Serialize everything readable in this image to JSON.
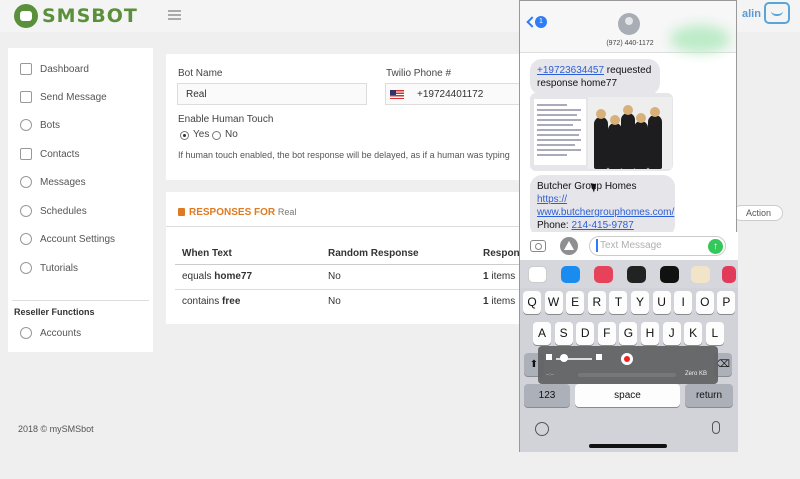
{
  "brand": {
    "name": "SMSBOT"
  },
  "header": {
    "user": "alin"
  },
  "sidebar": {
    "items": [
      {
        "label": "Dashboard"
      },
      {
        "label": "Send Message"
      },
      {
        "label": "Bots"
      },
      {
        "label": "Contacts"
      },
      {
        "label": "Messages"
      },
      {
        "label": "Schedules"
      },
      {
        "label": "Account Settings"
      },
      {
        "label": "Tutorials"
      }
    ],
    "reseller_title": "Reseller Functions",
    "reseller_items": [
      {
        "label": "Accounts"
      }
    ]
  },
  "footer": {
    "copyright": "2018 © mySMSbot"
  },
  "bot_form": {
    "bot_name_label": "Bot Name",
    "bot_name_value": "Real",
    "twilio_label": "Twilio Phone #",
    "twilio_value": "+19724401172",
    "human_touch_label": "Enable Human Touch",
    "yes_label": "Yes",
    "no_label": "No",
    "human_touch_selected": "Yes",
    "hint": "If human touch enabled, the bot response will be delayed, as if a human was typing"
  },
  "responses": {
    "title": "RESPONSES FOR",
    "bot": "Real",
    "action_label": "Action",
    "columns": [
      "When Text",
      "Random Response",
      "Respons"
    ],
    "rows": [
      {
        "match": "equals",
        "keyword": "home77",
        "random": "No",
        "count": "1",
        "unit": "items"
      },
      {
        "match": "contains",
        "keyword": "free",
        "random": "No",
        "count": "1",
        "unit": "items"
      }
    ]
  },
  "phone": {
    "back_badge": "1",
    "contact_number": "(972) 440-1172",
    "msg1_link": "+19723634457",
    "msg1_text": " requested response home77",
    "msg2_title": "Butcher Group Homes",
    "msg2_link_a": "https://",
    "msg2_link_b": "www.butchergrouphomes.com/",
    "msg2_phone_label": "Phone: ",
    "msg2_phone": "214-415-9787",
    "input_placeholder": "Text Message",
    "keyboard": {
      "row1": [
        "Q",
        "W",
        "E",
        "R",
        "T",
        "Y",
        "U",
        "I",
        "O",
        "P"
      ],
      "row2": [
        "A",
        "S",
        "D",
        "F",
        "G",
        "H",
        "J",
        "K",
        "L"
      ],
      "key_123": "123",
      "key_space": "space",
      "key_return": "return"
    },
    "recorder_time": "--:--",
    "recorder_size": "Zero KB"
  },
  "colors": {
    "brand_green": "#5a8f3b",
    "accent_orange": "#e07a20",
    "ios_blue": "#2e7cf6",
    "ios_green": "#34c759"
  }
}
